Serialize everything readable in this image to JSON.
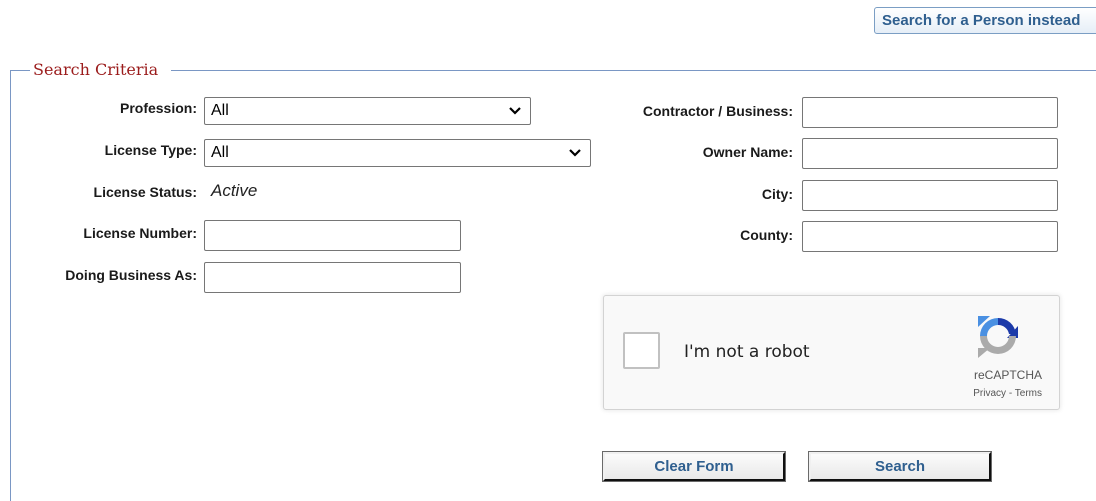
{
  "top_button": {
    "label": "Search for a Person instead"
  },
  "fieldset": {
    "legend": "Search Criteria"
  },
  "left": {
    "profession": {
      "label": "Profession:",
      "value": "All"
    },
    "license_type": {
      "label": "License Type:",
      "value": "All"
    },
    "license_status": {
      "label": "License Status:",
      "value": "Active"
    },
    "license_number": {
      "label": "License Number:",
      "value": ""
    },
    "doing_business_as": {
      "label": "Doing Business As:",
      "value": ""
    }
  },
  "right": {
    "contractor_business": {
      "label": "Contractor / Business:",
      "value": ""
    },
    "owner_name": {
      "label": "Owner Name:",
      "value": ""
    },
    "city": {
      "label": "City:",
      "value": ""
    },
    "county": {
      "label": "County:",
      "value": ""
    }
  },
  "recaptcha": {
    "label": "I'm not a robot",
    "brand": "reCAPTCHA",
    "privacy": "Privacy",
    "separator": " - ",
    "terms": "Terms"
  },
  "buttons": {
    "clear": "Clear Form",
    "search": "Search"
  }
}
